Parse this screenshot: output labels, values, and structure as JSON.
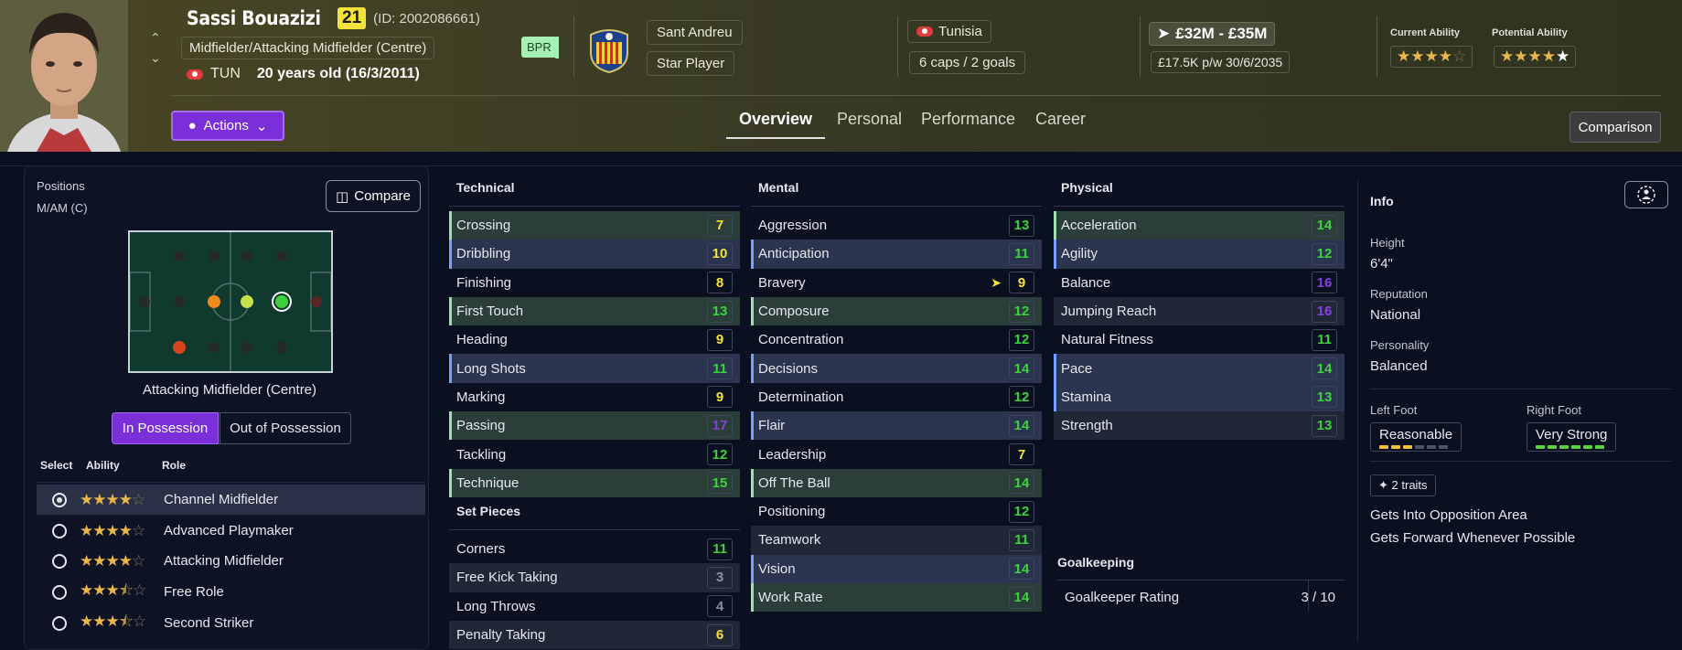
{
  "player": {
    "name": "Sassi Bouazizi",
    "age_badge": "21",
    "id_text": "(ID: 2002086661)",
    "position": "Midfielder/Attacking Midfielder (Centre)",
    "nationality_code": "TUN",
    "age_text": "20 years old (16/3/2011)",
    "tag": "BPR"
  },
  "club": {
    "name": "Sant Andreu",
    "status": "Star Player"
  },
  "country": {
    "name": "Tunisia",
    "caps": "6 caps / 2 goals"
  },
  "contract": {
    "value": "£32M - £35M",
    "wage": "£17.5K p/w 30/6/2035"
  },
  "ability": {
    "current_label": "Current Ability",
    "current_stars": 4.0,
    "potential_label": "Potential Ability",
    "potential_stars": 5.0
  },
  "actions_label": "Actions",
  "tabs": [
    "Overview",
    "Personal",
    "Performance",
    "Career"
  ],
  "comparison_label": "Comparison",
  "left": {
    "positions_label": "Positions",
    "positions_value": "M/AM (C)",
    "compare_label": "Compare",
    "role_title": "Attacking Midfielder (Centre)",
    "in_possession": "In Possession",
    "out_possession": "Out of Possession",
    "role_headers": {
      "select": "Select",
      "ability": "Ability",
      "role": "Role"
    },
    "roles": [
      {
        "name": "Channel Midfielder",
        "stars": 4.0,
        "selected": true
      },
      {
        "name": "Advanced Playmaker",
        "stars": 4.0,
        "selected": false
      },
      {
        "name": "Attacking Midfielder",
        "stars": 4.0,
        "selected": false
      },
      {
        "name": "Free Role",
        "stars": 3.5,
        "selected": false
      },
      {
        "name": "Second Striker",
        "stars": 3.5,
        "selected": false
      }
    ]
  },
  "technical": {
    "title": "Technical",
    "attrs": [
      {
        "name": "Crossing",
        "value": "7"
      },
      {
        "name": "Dribbling",
        "value": "10"
      },
      {
        "name": "Finishing",
        "value": "8"
      },
      {
        "name": "First Touch",
        "value": "13"
      },
      {
        "name": "Heading",
        "value": "9"
      },
      {
        "name": "Long Shots",
        "value": "11"
      },
      {
        "name": "Marking",
        "value": "9"
      },
      {
        "name": "Passing",
        "value": "17"
      },
      {
        "name": "Tackling",
        "value": "12"
      },
      {
        "name": "Technique",
        "value": "15"
      }
    ]
  },
  "set_pieces": {
    "title": "Set Pieces",
    "attrs": [
      {
        "name": "Corners",
        "value": "11"
      },
      {
        "name": "Free Kick Taking",
        "value": "3"
      },
      {
        "name": "Long Throws",
        "value": "4"
      },
      {
        "name": "Penalty Taking",
        "value": "6"
      }
    ]
  },
  "mental": {
    "title": "Mental",
    "attrs": [
      {
        "name": "Aggression",
        "value": "13"
      },
      {
        "name": "Anticipation",
        "value": "11"
      },
      {
        "name": "Bravery",
        "value": "9"
      },
      {
        "name": "Composure",
        "value": "12"
      },
      {
        "name": "Concentration",
        "value": "12"
      },
      {
        "name": "Decisions",
        "value": "14"
      },
      {
        "name": "Determination",
        "value": "12"
      },
      {
        "name": "Flair",
        "value": "14"
      },
      {
        "name": "Leadership",
        "value": "7"
      },
      {
        "name": "Off The Ball",
        "value": "14"
      },
      {
        "name": "Positioning",
        "value": "12"
      },
      {
        "name": "Teamwork",
        "value": "11"
      },
      {
        "name": "Vision",
        "value": "14"
      },
      {
        "name": "Work Rate",
        "value": "14"
      }
    ]
  },
  "physical": {
    "title": "Physical",
    "attrs": [
      {
        "name": "Acceleration",
        "value": "14"
      },
      {
        "name": "Agility",
        "value": "12"
      },
      {
        "name": "Balance",
        "value": "16"
      },
      {
        "name": "Jumping Reach",
        "value": "16"
      },
      {
        "name": "Natural Fitness",
        "value": "11"
      },
      {
        "name": "Pace",
        "value": "14"
      },
      {
        "name": "Stamina",
        "value": "13"
      },
      {
        "name": "Strength",
        "value": "13"
      }
    ]
  },
  "goalkeeping": {
    "title": "Goalkeeping",
    "label": "Goalkeeper Rating",
    "value": "3 / 10"
  },
  "info": {
    "title": "Info",
    "height_label": "Height",
    "height": "6'4\"",
    "reputation_label": "Reputation",
    "reputation": "National",
    "personality_label": "Personality",
    "personality": "Balanced",
    "left_foot_label": "Left Foot",
    "left_foot": "Reasonable",
    "right_foot_label": "Right Foot",
    "right_foot": "Very Strong",
    "traits_label": "2 traits",
    "traits": [
      "Gets Into Opposition Area",
      "Gets Forward Whenever Possible"
    ]
  },
  "colors": {
    "accent": "#7a2fd8",
    "high": "#3ed13e",
    "mid": "#f2e23a",
    "elite": "#8a3ee0",
    "low": "#8b90a0"
  }
}
